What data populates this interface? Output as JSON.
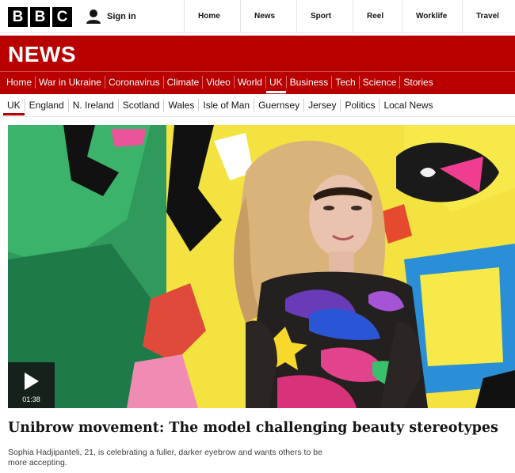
{
  "brand": {
    "letters": [
      "B",
      "B",
      "C"
    ]
  },
  "account": {
    "signin_label": "Sign in",
    "icon": "user-icon"
  },
  "top_nav": [
    "Home",
    "News",
    "Sport",
    "Reel",
    "Worklife",
    "Travel"
  ],
  "news_header": {
    "title": "NEWS"
  },
  "section_nav": [
    "Home",
    "War in Ukraine",
    "Coronavirus",
    "Climate",
    "Video",
    "World",
    "UK",
    "Business",
    "Tech",
    "Science",
    "Stories"
  ],
  "section_nav_active": "UK",
  "sub_nav": [
    "UK",
    "England",
    "N. Ireland",
    "Scotland",
    "Wales",
    "Isle of Man",
    "Guernsey",
    "Jersey",
    "Politics",
    "Local News"
  ],
  "sub_nav_active": "UK",
  "video": {
    "duration": "01:38",
    "icon": "play-icon"
  },
  "article": {
    "headline": "Unibrow movement: The model challenging beauty stereotypes",
    "summary": "Sophia Hadjipanteli, 21, is celebrating a fuller, darker eyebrow and wants others to be more accepting."
  },
  "colors": {
    "brand_red": "#b80000",
    "text": "#141414"
  }
}
